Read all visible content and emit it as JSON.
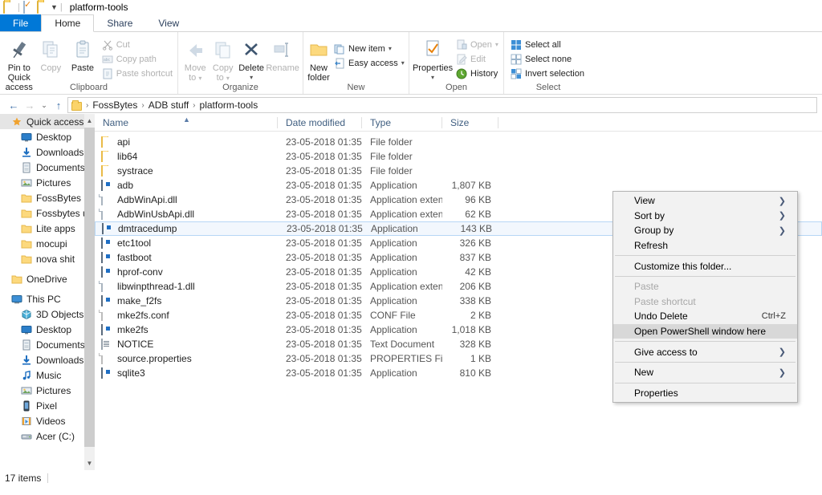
{
  "window": {
    "title": "platform-tools",
    "qat": [
      {
        "name": "folder-icon",
        "label": "Folder"
      },
      {
        "name": "properties-icon",
        "label": "Properties"
      },
      {
        "name": "new-folder-icon",
        "label": "New folder"
      },
      {
        "name": "chevron-down-icon",
        "label": "Customize Quick Access Toolbar"
      }
    ]
  },
  "tabs": [
    {
      "label": "File",
      "active": false,
      "kind": "file"
    },
    {
      "label": "Home",
      "active": true,
      "kind": "normal"
    },
    {
      "label": "Share",
      "active": false,
      "kind": "normal"
    },
    {
      "label": "View",
      "active": false,
      "kind": "normal"
    }
  ],
  "ribbon": {
    "groups": [
      {
        "label": "Clipboard",
        "big": [
          {
            "label_line1": "Pin to Quick",
            "label_line2": "access",
            "icon": "pin-icon",
            "dim": false
          },
          {
            "label_line1": "Copy",
            "label_line2": "",
            "icon": "copy-icon",
            "dim": true
          },
          {
            "label_line1": "Paste",
            "label_line2": "",
            "icon": "paste-icon",
            "dim": false
          }
        ],
        "small": [
          {
            "label": "Cut",
            "icon": "scissors-icon",
            "dim": true,
            "caret": false
          },
          {
            "label": "Copy path",
            "icon": "copy-path-icon",
            "dim": true,
            "caret": false
          },
          {
            "label": "Paste shortcut",
            "icon": "paste-shortcut-icon",
            "dim": true,
            "caret": false
          }
        ]
      },
      {
        "label": "Organize",
        "big": [
          {
            "label_line1": "Move",
            "label_line2": "to",
            "icon": "move-to-icon",
            "dim": true,
            "caret": true
          },
          {
            "label_line1": "Copy",
            "label_line2": "to",
            "icon": "copy-to-icon",
            "dim": true,
            "caret": true
          },
          {
            "label_line1": "Delete",
            "label_line2": "",
            "icon": "delete-icon",
            "dim": false,
            "caret": true
          },
          {
            "label_line1": "Rename",
            "label_line2": "",
            "icon": "rename-icon",
            "dim": true
          }
        ],
        "small": []
      },
      {
        "label": "New",
        "big": [
          {
            "label_line1": "New",
            "label_line2": "folder",
            "icon": "new-folder-icon",
            "dim": false
          }
        ],
        "small": [
          {
            "label": "New item",
            "icon": "new-item-icon",
            "dim": false,
            "caret": true
          },
          {
            "label": "Easy access",
            "icon": "easy-access-icon",
            "dim": false,
            "caret": true
          }
        ]
      },
      {
        "label": "Open",
        "big": [
          {
            "label_line1": "Properties",
            "label_line2": "",
            "icon": "properties-icon",
            "dim": false,
            "caret": true
          }
        ],
        "small": [
          {
            "label": "Open",
            "icon": "open-icon",
            "dim": true,
            "caret": true
          },
          {
            "label": "Edit",
            "icon": "edit-icon",
            "dim": true,
            "caret": false
          },
          {
            "label": "History",
            "icon": "history-icon",
            "dim": false,
            "caret": false
          }
        ]
      },
      {
        "label": "Select",
        "big": [],
        "small": [
          {
            "label": "Select all",
            "icon": "select-all-icon",
            "dim": false,
            "caret": false
          },
          {
            "label": "Select none",
            "icon": "select-none-icon",
            "dim": false,
            "caret": false
          },
          {
            "label": "Invert selection",
            "icon": "invert-selection-icon",
            "dim": false,
            "caret": false
          }
        ]
      }
    ]
  },
  "navbar": {
    "back": "←",
    "forward": "→",
    "recent": "⌄",
    "up": "↑",
    "breadcrumbs": [
      "FossBytes",
      "ADB stuff",
      "platform-tools"
    ],
    "separator": "›"
  },
  "sidebar": {
    "items": [
      {
        "label": "Quick access",
        "icon": "star-icon",
        "indent": 1,
        "selected": true,
        "pinned": false
      },
      {
        "label": "Desktop",
        "icon": "desktop-icon",
        "indent": 2,
        "selected": false,
        "pinned": true
      },
      {
        "label": "Downloads",
        "icon": "downloads-icon",
        "indent": 2,
        "selected": false,
        "pinned": true
      },
      {
        "label": "Documents",
        "icon": "documents-icon",
        "indent": 2,
        "selected": false,
        "pinned": true
      },
      {
        "label": "Pictures",
        "icon": "pictures-icon",
        "indent": 2,
        "selected": false,
        "pinned": true
      },
      {
        "label": "FossBytes",
        "icon": "folder-icon",
        "indent": 2,
        "selected": false,
        "pinned": true
      },
      {
        "label": "Fossbytes used I",
        "icon": "folder-icon",
        "indent": 2,
        "selected": false,
        "pinned": false
      },
      {
        "label": "Lite apps",
        "icon": "folder-icon",
        "indent": 2,
        "selected": false,
        "pinned": false
      },
      {
        "label": "mocupi",
        "icon": "folder-icon",
        "indent": 2,
        "selected": false,
        "pinned": false
      },
      {
        "label": "nova shit",
        "icon": "folder-icon",
        "indent": 2,
        "selected": false,
        "pinned": false
      },
      {
        "label": "",
        "icon": "spacer",
        "indent": 0,
        "selected": false,
        "pinned": false
      },
      {
        "label": "OneDrive",
        "icon": "onedrive-folder-icon",
        "indent": 1,
        "selected": false,
        "pinned": false
      },
      {
        "label": "",
        "icon": "spacer",
        "indent": 0,
        "selected": false,
        "pinned": false
      },
      {
        "label": "This PC",
        "icon": "pc-icon",
        "indent": 1,
        "selected": false,
        "pinned": false
      },
      {
        "label": "3D Objects",
        "icon": "3d-objects-icon",
        "indent": 2,
        "selected": false,
        "pinned": false
      },
      {
        "label": "Desktop",
        "icon": "desktop-icon",
        "indent": 2,
        "selected": false,
        "pinned": false
      },
      {
        "label": "Documents",
        "icon": "documents-icon",
        "indent": 2,
        "selected": false,
        "pinned": false
      },
      {
        "label": "Downloads",
        "icon": "downloads-icon",
        "indent": 2,
        "selected": false,
        "pinned": false
      },
      {
        "label": "Music",
        "icon": "music-icon",
        "indent": 2,
        "selected": false,
        "pinned": false
      },
      {
        "label": "Pictures",
        "icon": "pictures-icon",
        "indent": 2,
        "selected": false,
        "pinned": false
      },
      {
        "label": "Pixel",
        "icon": "phone-icon",
        "indent": 2,
        "selected": false,
        "pinned": false
      },
      {
        "label": "Videos",
        "icon": "videos-icon",
        "indent": 2,
        "selected": false,
        "pinned": false
      },
      {
        "label": "Acer (C:)",
        "icon": "drive-icon",
        "indent": 2,
        "selected": false,
        "pinned": false
      }
    ]
  },
  "filelist": {
    "columns": [
      {
        "label": "Name",
        "key": "name"
      },
      {
        "label": "Date modified",
        "key": "date"
      },
      {
        "label": "Type",
        "key": "type"
      },
      {
        "label": "Size",
        "key": "size"
      }
    ],
    "sort_column": "Name",
    "sort_direction": "asc",
    "rows": [
      {
        "name": "api",
        "date": "23-05-2018 01:35",
        "type": "File folder",
        "size": "",
        "icon": "folder-icon",
        "selected": false
      },
      {
        "name": "lib64",
        "date": "23-05-2018 01:35",
        "type": "File folder",
        "size": "",
        "icon": "folder-icon",
        "selected": false
      },
      {
        "name": "systrace",
        "date": "23-05-2018 01:35",
        "type": "File folder",
        "size": "",
        "icon": "folder-icon",
        "selected": false
      },
      {
        "name": "adb",
        "date": "23-05-2018 01:35",
        "type": "Application",
        "size": "1,807 KB",
        "icon": "application-icon",
        "selected": false
      },
      {
        "name": "AdbWinApi.dll",
        "date": "23-05-2018 01:35",
        "type": "Application extens",
        "size": "96 KB",
        "icon": "dll-icon",
        "selected": false
      },
      {
        "name": "AdbWinUsbApi.dll",
        "date": "23-05-2018 01:35",
        "type": "Application extens",
        "size": "62 KB",
        "icon": "dll-icon",
        "selected": false
      },
      {
        "name": "dmtracedump",
        "date": "23-05-2018 01:35",
        "type": "Application",
        "size": "143 KB",
        "icon": "application-icon",
        "selected": true
      },
      {
        "name": "etc1tool",
        "date": "23-05-2018 01:35",
        "type": "Application",
        "size": "326 KB",
        "icon": "application-icon",
        "selected": false
      },
      {
        "name": "fastboot",
        "date": "23-05-2018 01:35",
        "type": "Application",
        "size": "837 KB",
        "icon": "application-icon",
        "selected": false
      },
      {
        "name": "hprof-conv",
        "date": "23-05-2018 01:35",
        "type": "Application",
        "size": "42 KB",
        "icon": "application-icon",
        "selected": false
      },
      {
        "name": "libwinpthread-1.dll",
        "date": "23-05-2018 01:35",
        "type": "Application extens",
        "size": "206 KB",
        "icon": "dll-icon",
        "selected": false
      },
      {
        "name": "make_f2fs",
        "date": "23-05-2018 01:35",
        "type": "Application",
        "size": "338 KB",
        "icon": "application-icon",
        "selected": false
      },
      {
        "name": "mke2fs.conf",
        "date": "23-05-2018 01:35",
        "type": "CONF File",
        "size": "2 KB",
        "icon": "generic-file-icon",
        "selected": false
      },
      {
        "name": "mke2fs",
        "date": "23-05-2018 01:35",
        "type": "Application",
        "size": "1,018 KB",
        "icon": "application-icon",
        "selected": false
      },
      {
        "name": "NOTICE",
        "date": "23-05-2018 01:35",
        "type": "Text Document",
        "size": "328 KB",
        "icon": "text-document-icon",
        "selected": false
      },
      {
        "name": "source.properties",
        "date": "23-05-2018 01:35",
        "type": "PROPERTIES File",
        "size": "1 KB",
        "icon": "generic-file-icon",
        "selected": false
      },
      {
        "name": "sqlite3",
        "date": "23-05-2018 01:35",
        "type": "Application",
        "size": "810 KB",
        "icon": "application-icon",
        "selected": false
      }
    ]
  },
  "statusbar": {
    "item_count": "17 items"
  },
  "context_menu": {
    "items": [
      {
        "label": "View",
        "submenu": true,
        "disabled": false,
        "highlighted": false,
        "accel": "",
        "sep_after": false
      },
      {
        "label": "Sort by",
        "submenu": true,
        "disabled": false,
        "highlighted": false,
        "accel": "",
        "sep_after": false
      },
      {
        "label": "Group by",
        "submenu": true,
        "disabled": false,
        "highlighted": false,
        "accel": "",
        "sep_after": false
      },
      {
        "label": "Refresh",
        "submenu": false,
        "disabled": false,
        "highlighted": false,
        "accel": "",
        "sep_after": true
      },
      {
        "label": "Customize this folder...",
        "submenu": false,
        "disabled": false,
        "highlighted": false,
        "accel": "",
        "sep_after": true
      },
      {
        "label": "Paste",
        "submenu": false,
        "disabled": true,
        "highlighted": false,
        "accel": "",
        "sep_after": false
      },
      {
        "label": "Paste shortcut",
        "submenu": false,
        "disabled": true,
        "highlighted": false,
        "accel": "",
        "sep_after": false
      },
      {
        "label": "Undo Delete",
        "submenu": false,
        "disabled": false,
        "highlighted": false,
        "accel": "Ctrl+Z",
        "sep_after": false
      },
      {
        "label": "Open PowerShell window here",
        "submenu": false,
        "disabled": false,
        "highlighted": true,
        "accel": "",
        "sep_after": true
      },
      {
        "label": "Give access to",
        "submenu": true,
        "disabled": false,
        "highlighted": false,
        "accel": "",
        "sep_after": true
      },
      {
        "label": "New",
        "submenu": true,
        "disabled": false,
        "highlighted": false,
        "accel": "",
        "sep_after": true
      },
      {
        "label": "Properties",
        "submenu": false,
        "disabled": false,
        "highlighted": false,
        "accel": "",
        "sep_after": false
      }
    ],
    "submenu_arrow": "❯"
  },
  "colors": {
    "accent": "#0078d7",
    "selection_fill": "#f2f7fd",
    "selection_border": "#b7d7f5",
    "menu_bg": "#f2f2f2",
    "menu_highlight": "#d8d8d8",
    "folder_yellow": "#fcd97e"
  }
}
